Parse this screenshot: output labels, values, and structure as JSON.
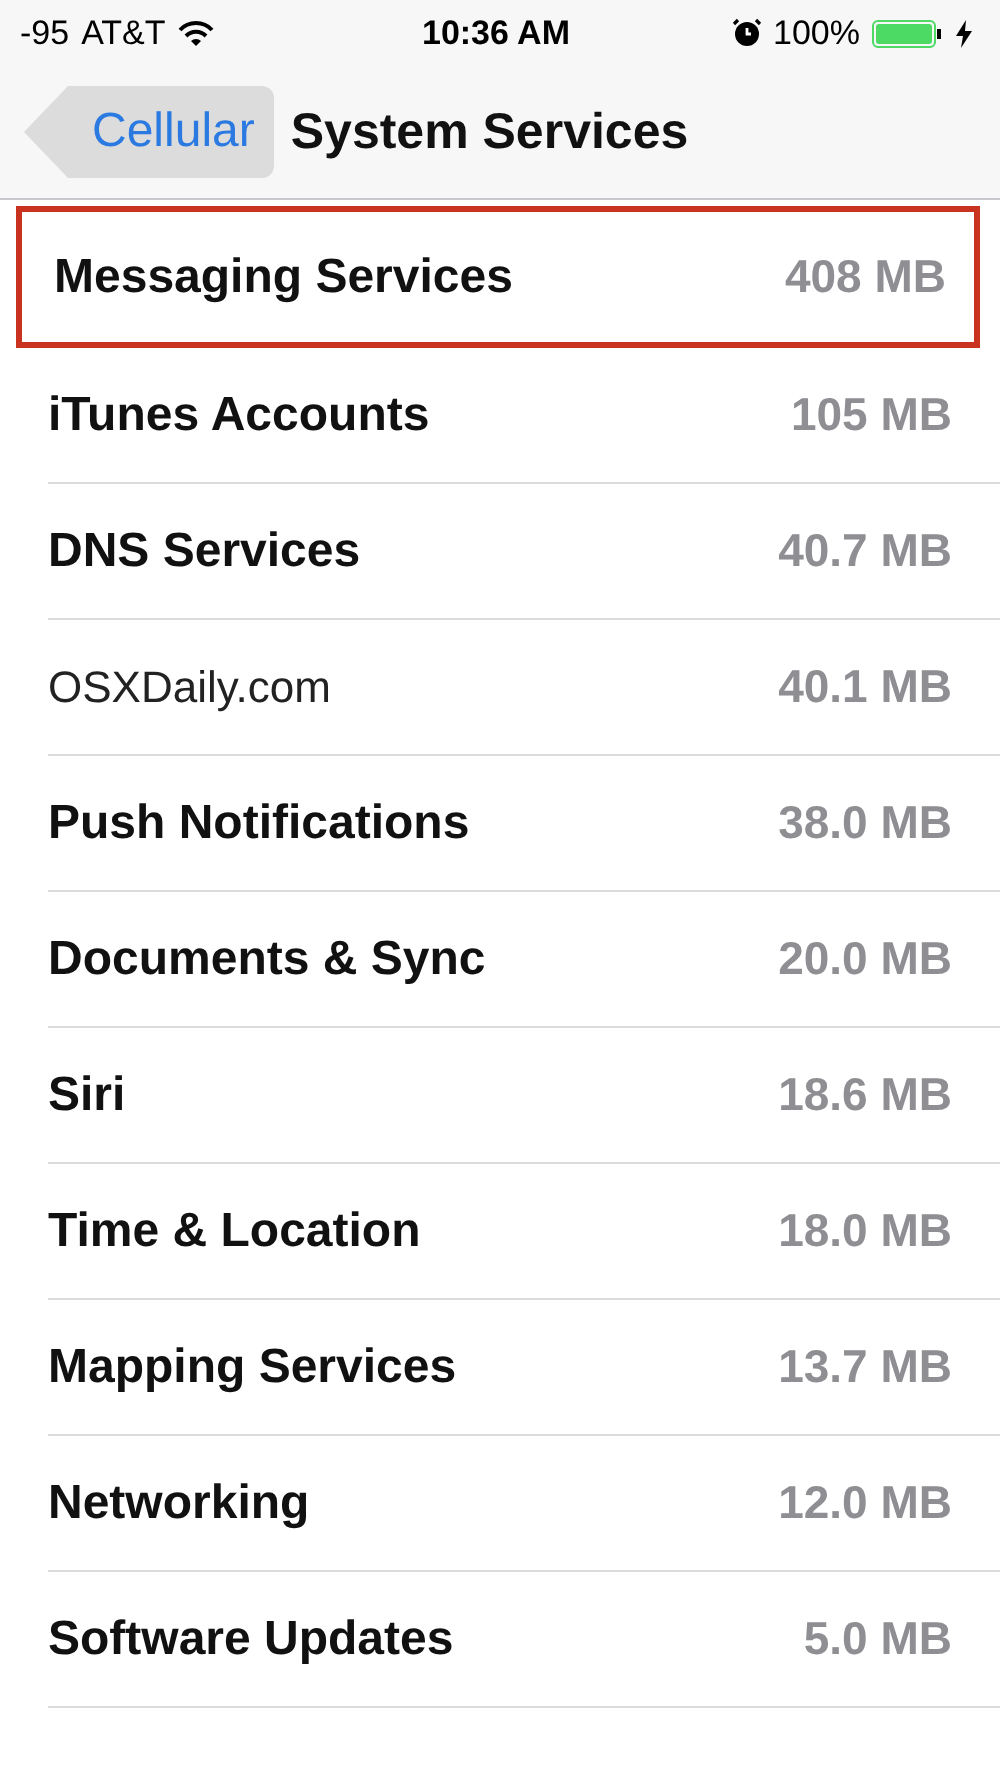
{
  "status_bar": {
    "signal": "-95",
    "carrier": "AT&T",
    "time": "10:36 AM",
    "battery": "100%"
  },
  "nav": {
    "back": "Cellular",
    "title": "System Services"
  },
  "services": [
    {
      "name": "Messaging Services",
      "usage": "408 MB",
      "highlighted": true,
      "kind": "bold"
    },
    {
      "name": "iTunes Accounts",
      "usage": "105 MB",
      "highlighted": false,
      "kind": "bold"
    },
    {
      "name": "DNS Services",
      "usage": "40.7 MB",
      "highlighted": false,
      "kind": "bold"
    },
    {
      "name": "OSXDaily.com",
      "usage": "40.1 MB",
      "highlighted": false,
      "kind": "plain"
    },
    {
      "name": "Push Notifications",
      "usage": "38.0 MB",
      "highlighted": false,
      "kind": "bold"
    },
    {
      "name": "Documents & Sync",
      "usage": "20.0 MB",
      "highlighted": false,
      "kind": "bold"
    },
    {
      "name": "Siri",
      "usage": "18.6 MB",
      "highlighted": false,
      "kind": "bold"
    },
    {
      "name": "Time & Location",
      "usage": "18.0 MB",
      "highlighted": false,
      "kind": "bold"
    },
    {
      "name": "Mapping Services",
      "usage": "13.7 MB",
      "highlighted": false,
      "kind": "bold"
    },
    {
      "name": "Networking",
      "usage": "12.0 MB",
      "highlighted": false,
      "kind": "bold"
    },
    {
      "name": "Software Updates",
      "usage": "5.0 MB",
      "highlighted": false,
      "kind": "bold"
    }
  ]
}
